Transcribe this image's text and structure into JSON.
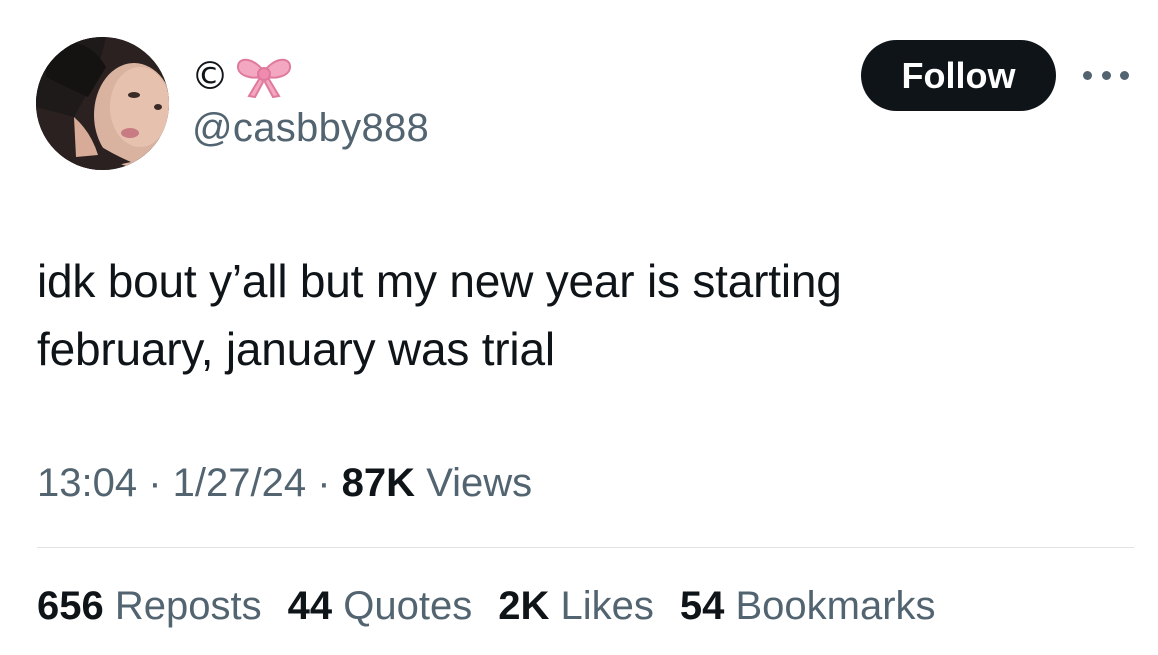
{
  "author": {
    "display_name": "©",
    "display_name_emoji": "ribbon-bow-icon",
    "handle": "@casbby888"
  },
  "follow_label": "Follow",
  "more_icon": "more-horizontal-icon",
  "tweet": {
    "lines": [
      "idk bout y’all but my new year is starting",
      "february, january was trial"
    ]
  },
  "meta": {
    "time": "13:04",
    "sep1": " · ",
    "date": "1/27/24",
    "sep2": " · ",
    "views_count": "87K",
    "views_label": "Views"
  },
  "stats": {
    "reposts": {
      "count": "656",
      "label": "Reposts"
    },
    "quotes": {
      "count": "44",
      "label": "Quotes"
    },
    "likes": {
      "count": "2K",
      "label": "Likes"
    },
    "bookmarks": {
      "count": "54",
      "label": "Bookmarks"
    }
  },
  "colors": {
    "text_primary": "#0f1419",
    "text_secondary": "#536471",
    "follow_bg": "#0f1419",
    "bow_pink": "#f4a7c0",
    "divider": "#dfe3e6"
  }
}
